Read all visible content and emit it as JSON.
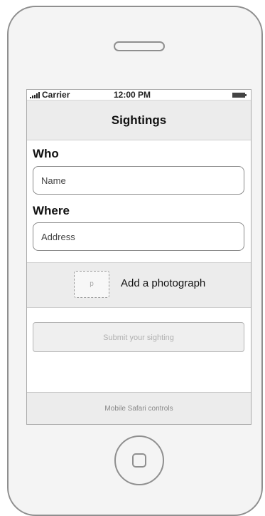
{
  "status_bar": {
    "carrier": "Carrier",
    "time": "12:00 PM",
    "signal_icon": "signal-bars-icon",
    "battery_icon": "battery-icon"
  },
  "nav": {
    "title": "Sightings"
  },
  "who": {
    "label": "Who",
    "name_placeholder": "Name"
  },
  "where": {
    "label": "Where",
    "address_placeholder": "Address"
  },
  "photo": {
    "placeholder_text": "p",
    "label": "Add a photograph"
  },
  "submit": {
    "label": "Submit your sighting"
  },
  "safari_controls": {
    "label": "Mobile Safari controls"
  },
  "colors": {
    "device_border": "#8f8f8f",
    "bar_background": "#ececec",
    "text": "#111111"
  }
}
